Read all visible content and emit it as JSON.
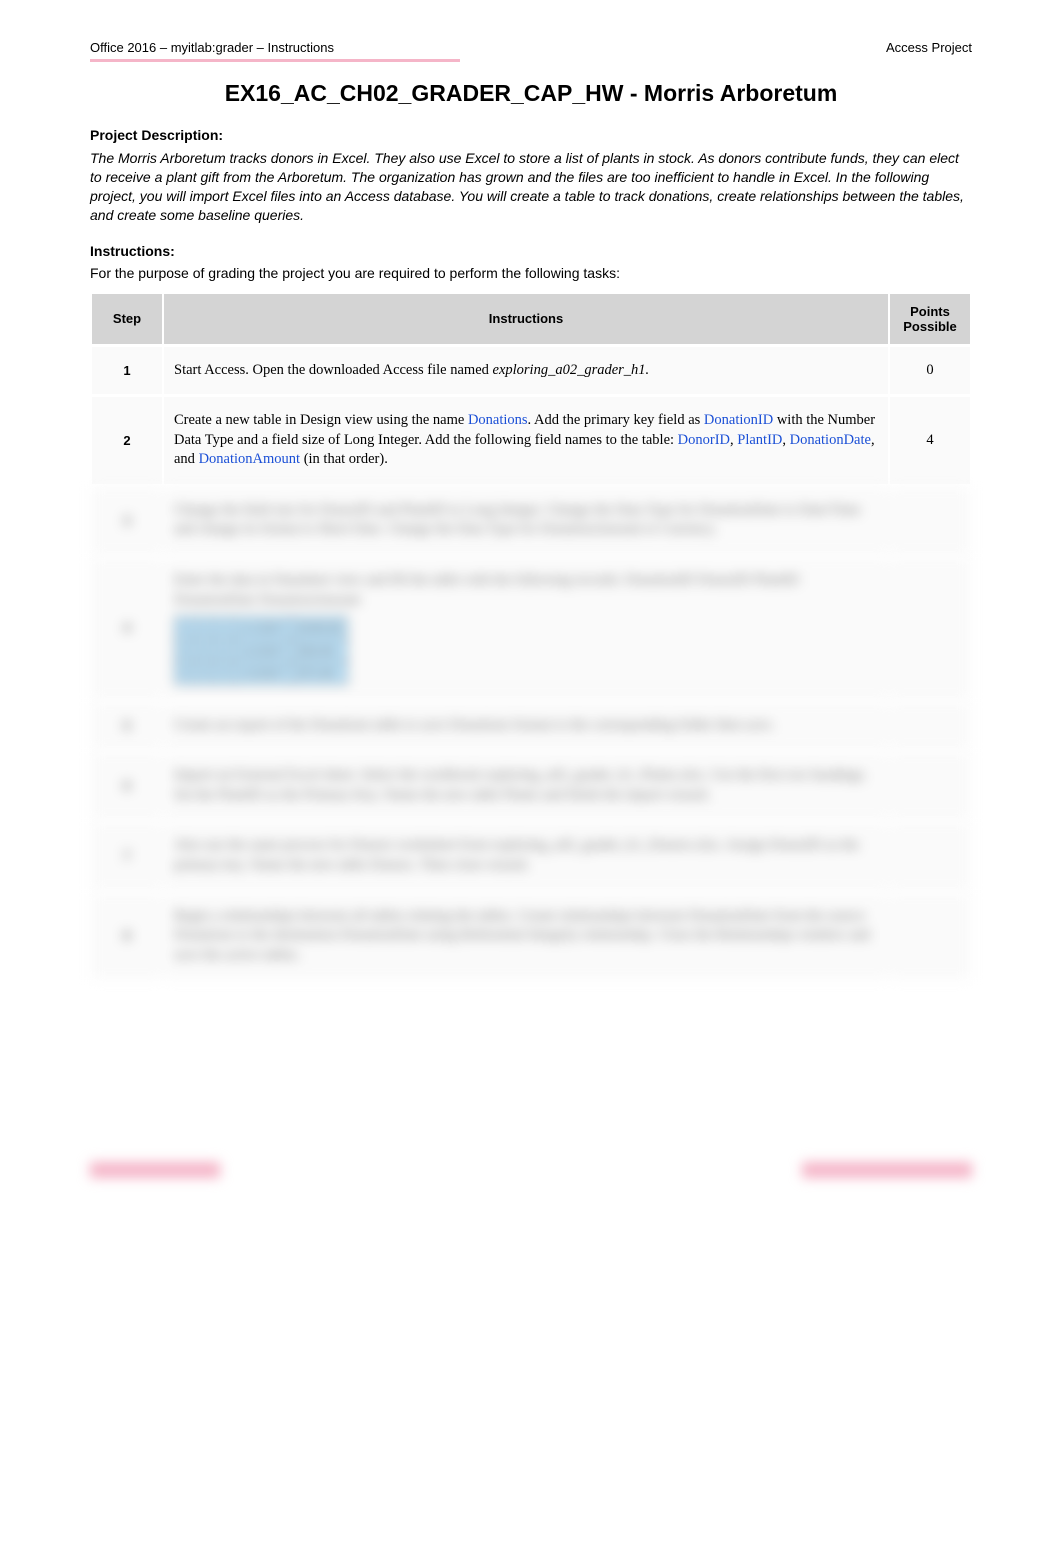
{
  "header": {
    "left": "Office 2016 – myitlab:grader – Instructions",
    "right": "Access Project"
  },
  "title": "EX16_AC_CH02_GRADER_CAP_HW - Morris Arboretum",
  "project_description_heading": "Project Description:",
  "project_description": "The Morris Arboretum tracks donors in Excel. They also use Excel to store a list of plants in stock. As donors contribute funds, they can elect to receive a plant gift from the Arboretum. The organization has grown and the files are too inefficient to handle in Excel. In the following project, you will import Excel files into an Access database. You will create a table to track donations, create relationships between the tables, and create some baseline queries.",
  "instructions_heading": "Instructions:",
  "instructions_intro": "For the purpose of grading the project you are required to perform the following tasks:",
  "table_headers": {
    "step": "Step",
    "instructions": "Instructions",
    "points": "Points Possible"
  },
  "rows": [
    {
      "step": "1",
      "text_pre": "Start Access. Open the downloaded Access file named ",
      "file": "exploring_a02_grader_h1.",
      "points": "0"
    },
    {
      "step": "2",
      "line1a": "Create a new table in Design view using the name ",
      "kw1": "Donations",
      "line1b": ". Add the primary key field as ",
      "kw2": "DonationID",
      "line2a": " with the Number Data Type and a field size of Long Integer. Add the following field names to the table: ",
      "kw3": "DonorID",
      "sep1": ", ",
      "kw4": "PlantID",
      "sep2": ", ",
      "kw5": "DonationDate",
      "sep3": ", and ",
      "kw6": "DonationAmount",
      "line2b": " (in that order).",
      "points": "4"
    }
  ],
  "blurred_rows": [
    {
      "step": "3",
      "text": "Change the field size for DonorID and PlantID to Long Integer. Change the Data Type for DonationDate to Date/Time and change its format to Short Date. Change the Data Type for DonationAmount to Currency."
    },
    {
      "step": "4",
      "text": "Enter the data in Datasheet view and fill the table with the following records: DonationID DonorID PlantID DonationDate DonationAmount"
    },
    {
      "step": "5",
      "text": "Create an export of the Donations table to save Donations format to the corresponding folder then save."
    },
    {
      "step": "6",
      "text": "Import an External Excel sheet. Select the workbook exploring_a02_grader_h1_Plants.xlsx. Use the first row headings. Set the PlantID as the Primary Key. Name the new table Plants and finish the import wizard."
    },
    {
      "step": "7",
      "text": "Also use the same process for Donors worksheet from exploring_a02_grader_h1_Donors.xlsx. Assign DonorID as the primary key. Name the new table Donors. Then close wizard."
    },
    {
      "step": "8",
      "text": "Begin a relationships between all tables relating the tables. Create relationships between DonationDate from the source Donations to the destination DonationDate using Referential Integrity relationship. Close the Relationships window and save the active tables."
    }
  ]
}
